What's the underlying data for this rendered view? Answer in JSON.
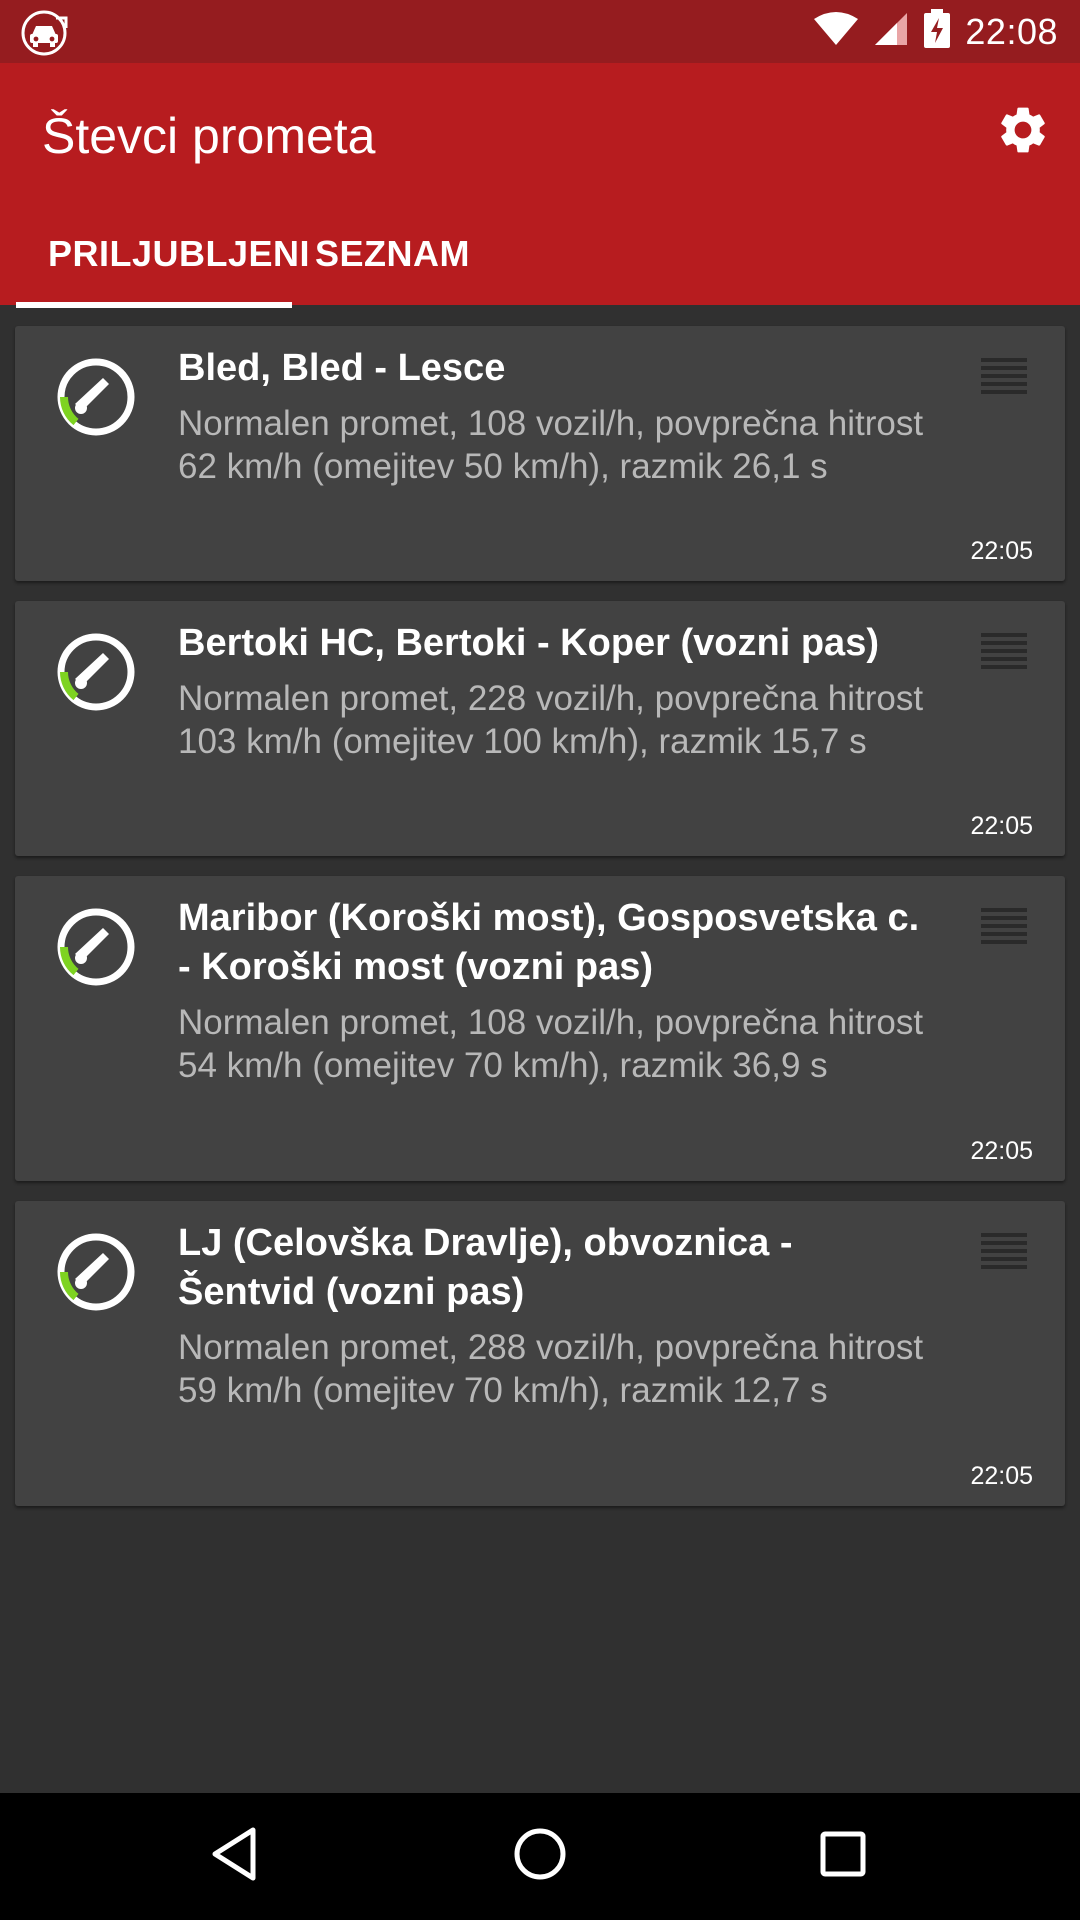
{
  "status_bar": {
    "time": "22:08",
    "left_icon": "traffic-car-icon",
    "icons": [
      "wifi-icon",
      "cell-signal-icon",
      "battery-charging-icon"
    ]
  },
  "app_bar": {
    "title": "Števci prometa",
    "settings_icon": "gear-icon",
    "background": "#b71c1f",
    "status_background": "#951c1f"
  },
  "tabs": [
    {
      "label": "PRILJUBLJENI",
      "active": true
    },
    {
      "label": "SEZNAM",
      "active": false
    }
  ],
  "counters": [
    {
      "title": "Bled, Bled - Lesce",
      "description": "Normalen promet, 108 vozil/h, povprečna hitrost 62 km/h (omejitev 50 km/h), razmik 26,1 s",
      "time": "22:05"
    },
    {
      "title": "Bertoki HC, Bertoki - Koper (vozni pas)",
      "description": "Normalen promet, 228 vozil/h, povprečna hitrost 103 km/h (omejitev 100 km/h), razmik 15,7 s",
      "time": "22:05"
    },
    {
      "title": "Maribor (Koroški most), Gosposvetska c. - Koroški most (vozni pas)",
      "description": "Normalen promet, 108 vozil/h, povprečna hitrost 54 km/h (omejitev 70 km/h), razmik 36,9 s",
      "time": "22:05"
    },
    {
      "title": "LJ (Celovška Dravlje), obvoznica - Šentvid (vozni pas)",
      "description": "Normalen promet, 288 vozil/h, povprečna hitrost 59 km/h (omejitev 70 km/h), razmik 12,7 s",
      "time": "22:05"
    }
  ],
  "gauge_color": "#7ed321",
  "nav_bar": {
    "icons": [
      "back-icon",
      "home-icon",
      "recents-icon"
    ]
  }
}
